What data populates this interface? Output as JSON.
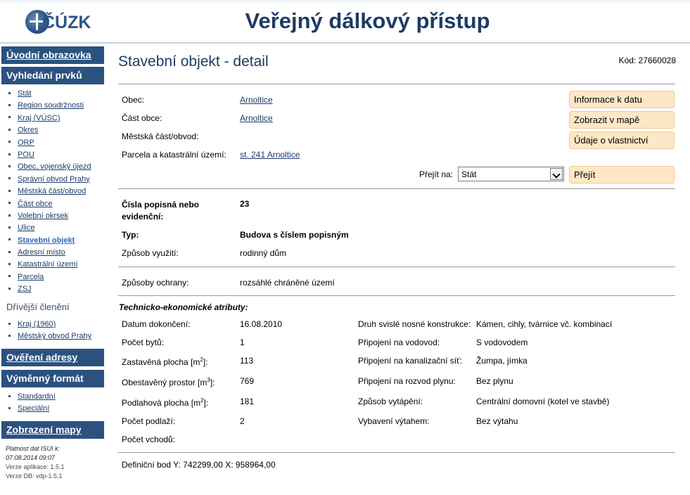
{
  "header": {
    "logo_text": "ČÚZK",
    "title": "Veřejný dálkový přístup"
  },
  "sidebar": {
    "home_label": "Úvodní obrazovka",
    "search_label": "Vyhledání prvků",
    "search_items": [
      {
        "label": "Stát"
      },
      {
        "label": "Region soudržnosti"
      },
      {
        "label": "Kraj (VÚSC)"
      },
      {
        "label": "Okres"
      },
      {
        "label": "ORP"
      },
      {
        "label": "POU"
      },
      {
        "label": "Obec, vojenský újezd"
      },
      {
        "label": "Správní obvod Prahy"
      },
      {
        "label": "Městská část/obvod"
      },
      {
        "label": "Část obce"
      },
      {
        "label": "Volební okrsek"
      },
      {
        "label": "Ulice"
      },
      {
        "label": "Stavební objekt"
      },
      {
        "label": "Adresní místo"
      },
      {
        "label": "Katastrální území"
      },
      {
        "label": "Parcela"
      },
      {
        "label": "ZSJ"
      }
    ],
    "former_label": "Dřívější členění",
    "former_items": [
      {
        "label": "Kraj (1960)"
      },
      {
        "label": "Městský obvod Prahy"
      }
    ],
    "verify_label": "Ověření adresy",
    "exchange_label": "Výměnný formát",
    "exchange_items": [
      {
        "label": "Standardní"
      },
      {
        "label": "Speciální"
      }
    ],
    "map_label": "Zobrazení mapy",
    "validity_label": "Platnost dat ISUI k:",
    "validity_value": "07.08.2014 09:07",
    "app_version": "Verze aplikace: 1.5.1",
    "db_version": "Verze DB: vdp-1.5.1"
  },
  "main": {
    "title": "Stavební objekt - detail",
    "code": "Kód: 27660028",
    "obec_label": "Obec:",
    "obec_value": "Arnoltice",
    "cast_obce_label": "Část obce:",
    "cast_obce_value": "Arnoltice",
    "mestska_cast_label": "Městská část/obvod:",
    "parcela_label": "Parcela a katastrální území:",
    "parcela_value": "st. 241 Arnoltice",
    "btn_info": "Informace k datu",
    "btn_map": "Zobrazit v mapě",
    "btn_owner": "Údaje o vlastnictví",
    "goto_label": "Přejít na:",
    "goto_selected": "Stát",
    "goto_button": "Přejít",
    "cisla_label": "Čísla popisná nebo evidenční:",
    "cisla_value": "23",
    "typ_label": "Typ:",
    "typ_value": "Budova s číslem popisným",
    "vyuziti_label": "Způsob využití:",
    "vyuziti_value": "rodinný dům",
    "ochrana_label": "Způsoby ochrany:",
    "ochrana_value": "rozsáhlé chráněné území",
    "tech_title": "Technicko-ekonomické atributy:",
    "tech_left": [
      {
        "label": "Datum dokončení:",
        "value": "16.08.2010"
      },
      {
        "label": "Počet bytů:",
        "value": "1"
      },
      {
        "label_pre": "Zastavěná plocha [m",
        "label_sup": "2",
        "label_post": "]:",
        "value": "113"
      },
      {
        "label_pre": "Obestavěný prostor [m",
        "label_sup": "3",
        "label_post": "]:",
        "value": "769"
      },
      {
        "label_pre": "Podlahová plocha [m",
        "label_sup": "2",
        "label_post": "]:",
        "value": "181"
      },
      {
        "label": "Počet podlaží:",
        "value": "2"
      },
      {
        "label": "Počet vchodů:",
        "value": ""
      }
    ],
    "tech_right": [
      {
        "label": "Druh svislé nosné konstrukce:",
        "value": "Kámen, cihly, tvárnice vč. kombinací"
      },
      {
        "label": "Připojení na vodovod:",
        "value": "S vodovodem"
      },
      {
        "label": "Připojení na kanalizační síť:",
        "value": "Žumpa, jímka"
      },
      {
        "label": "Připojení na rozvod plynu:",
        "value": "Bez plynu"
      },
      {
        "label": "Způsob vytápění:",
        "value": "Centrální domovní (kotel ve stavbě)"
      },
      {
        "label": "Vybavení výtahem:",
        "value": "Bez výtahu"
      }
    ],
    "definicni_bod": "Definiční bod Y: 742299,00 X: 958964,00"
  }
}
